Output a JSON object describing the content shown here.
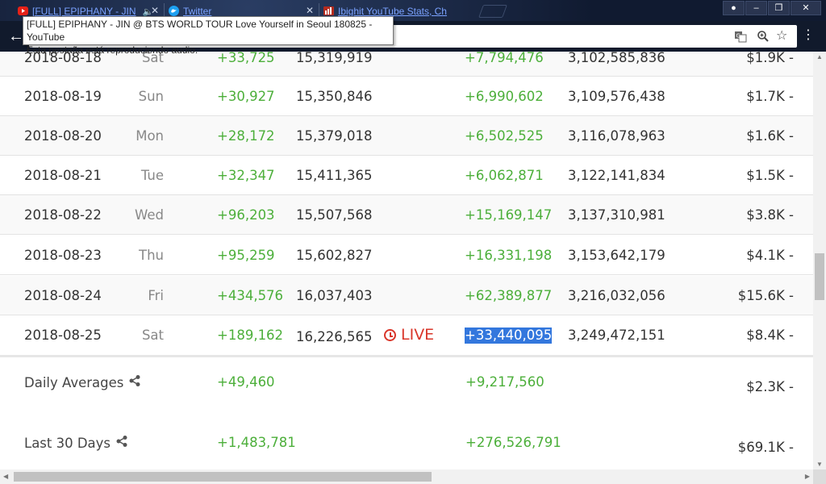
{
  "browser": {
    "tabs": [
      {
        "title": "[FULL] EPIPHANY - JIN",
        "icon": "youtube-icon",
        "audio": true
      },
      {
        "title": "Twitter",
        "icon": "twitter-icon"
      },
      {
        "title": "Ibighit YouTube Stats, Ch",
        "icon": "socialblade-icon"
      }
    ],
    "tooltip": {
      "line1": "[FULL] EPIPHANY - JIN @ BTS WORLD TOUR Love Yourself in Seoul 180825 - YouTube",
      "line2": "Esta pestaña está reproduciendo audio."
    },
    "colors": {
      "chrome": "#111a2c",
      "tab_text": "#7aa2ff"
    }
  },
  "table": {
    "rows": [
      {
        "date": "2018-08-18",
        "day": "Sat",
        "subs_gain": "+33,725",
        "subs_total": "15,319,919",
        "views_gain": "+7,794,476",
        "views_total": "3,102,585,836",
        "earnings": "$1.9K  -"
      },
      {
        "date": "2018-08-19",
        "day": "Sun",
        "subs_gain": "+30,927",
        "subs_total": "15,350,846",
        "views_gain": "+6,990,602",
        "views_total": "3,109,576,438",
        "earnings": "$1.7K  -"
      },
      {
        "date": "2018-08-20",
        "day": "Mon",
        "subs_gain": "+28,172",
        "subs_total": "15,379,018",
        "views_gain": "+6,502,525",
        "views_total": "3,116,078,963",
        "earnings": "$1.6K  -"
      },
      {
        "date": "2018-08-21",
        "day": "Tue",
        "subs_gain": "+32,347",
        "subs_total": "15,411,365",
        "views_gain": "+6,062,871",
        "views_total": "3,122,141,834",
        "earnings": "$1.5K  -"
      },
      {
        "date": "2018-08-22",
        "day": "Wed",
        "subs_gain": "+96,203",
        "subs_total": "15,507,568",
        "views_gain": "+15,169,147",
        "views_total": "3,137,310,981",
        "earnings": "$3.8K  -"
      },
      {
        "date": "2018-08-23",
        "day": "Thu",
        "subs_gain": "+95,259",
        "subs_total": "15,602,827",
        "views_gain": "+16,331,198",
        "views_total": "3,153,642,179",
        "earnings": "$4.1K  -"
      },
      {
        "date": "2018-08-24",
        "day": "Fri",
        "subs_gain": "+434,576",
        "subs_total": "16,037,403",
        "views_gain": "+62,389,877",
        "views_total": "3,216,032,056",
        "earnings": "$15.6K  -"
      },
      {
        "date": "2018-08-25",
        "day": "Sat",
        "subs_gain": "+189,162",
        "subs_total": "16,226,565",
        "live": "LIVE",
        "views_gain": "+33,440,095",
        "views_total": "3,249,472,151",
        "earnings": "$8.4K  -"
      }
    ],
    "summary": [
      {
        "label": "Daily Averages",
        "subs": "+49,460",
        "views": "+9,217,560",
        "earnings": "$2.3K  -"
      },
      {
        "label": "Last 30 Days",
        "subs": "+1,483,781",
        "views": "+276,526,791",
        "earnings": "$69.1K  -"
      }
    ],
    "colors": {
      "gain": "#4caf3a",
      "live": "#d9362a",
      "selection": "#3377dd"
    }
  }
}
